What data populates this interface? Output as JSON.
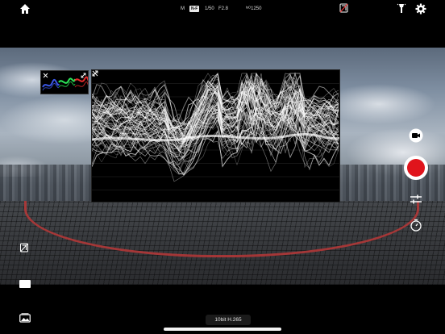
{
  "status": {
    "mode": "M",
    "log": "N-F",
    "shutter": "1/50",
    "aperture": "F2.8",
    "iso": "ᴵˢᴼ1250"
  },
  "icons": {
    "home": "home-icon",
    "no_filter": "no-filter-icon",
    "flashlight": "flashlight-icon",
    "settings": "gear-icon",
    "camera_mode": "video-camera-icon",
    "record": "record-icon",
    "adjust": "sliders-icon",
    "timer": "timer-icon",
    "aspect": "aspect-ratio-icon",
    "gallery": "gallery-icon",
    "close": "close-icon",
    "expand": "expand-icon"
  },
  "bottom": {
    "codec": "10bit H.265"
  },
  "colors": {
    "record": "#e0141c",
    "rgb_red": "#ff3030",
    "rgb_green": "#30ff60",
    "rgb_blue": "#4060ff"
  }
}
